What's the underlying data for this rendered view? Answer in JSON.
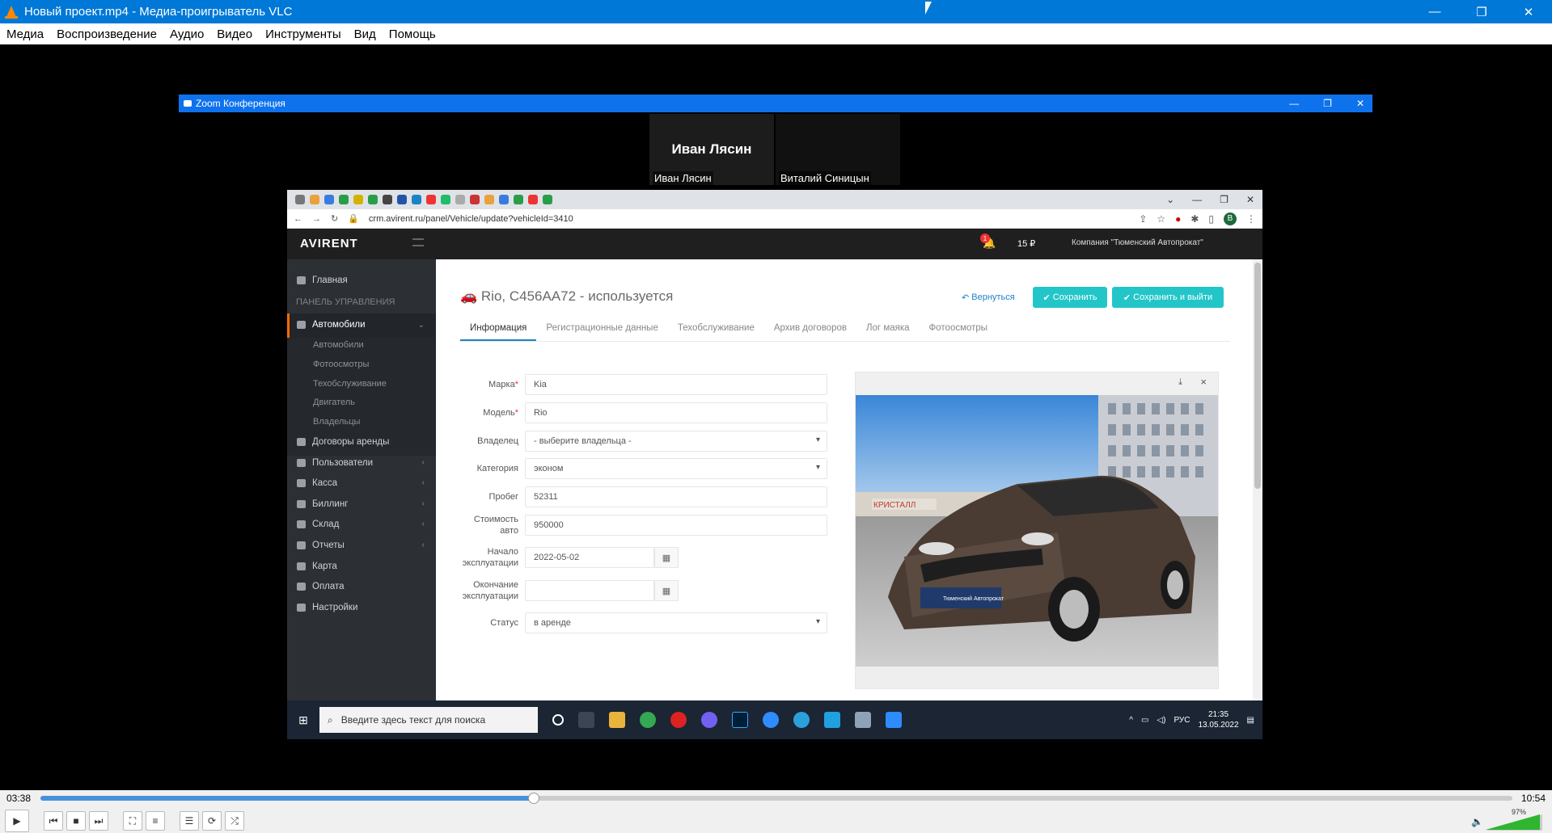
{
  "vlc": {
    "title": "Новый проект.mp4 - Медиа-проигрыватель VLC",
    "menu": [
      "Медиа",
      "Воспроизведение",
      "Аудио",
      "Видео",
      "Инструменты",
      "Вид",
      "Помощь"
    ],
    "time_current": "03:38",
    "time_total": "10:54",
    "progress": 0.335,
    "volume": "97%"
  },
  "zoom": {
    "title": "Zoom Конференция",
    "participant_1_name_big": "Иван Лясин",
    "participant_1_label": "Иван Лясин",
    "participant_2_label": "Виталий Синицын"
  },
  "browser": {
    "url": "crm.avirent.ru/panel/Vehicle/update?vehicleId=3410",
    "profile_letter": "B"
  },
  "crm": {
    "logo": "AVIRENT",
    "notifications": "1",
    "balance": "15 ₽",
    "company": "Компания \"Тюменский Автопрокат\"",
    "sidebar": {
      "home": "Главная",
      "panel_header": "ПАНЕЛЬ УПРАВЛЕНИЯ",
      "cars": "Автомобили",
      "sub": [
        "Автомобили",
        "Фотоосмотры",
        "Техобслуживание",
        "Двигатель",
        "Владельцы"
      ],
      "items": [
        "Договоры аренды",
        "Пользователи",
        "Касса",
        "Биллинг",
        "Склад",
        "Отчеты",
        "Карта",
        "Оплата",
        "Настройки"
      ]
    },
    "page_title": "Rio, С456АА72 - используется",
    "back": "Вернуться",
    "save": "Сохранить",
    "save_exit": "Сохранить и выйти",
    "tabs": [
      "Информация",
      "Регистрационные данные",
      "Техобслуживание",
      "Архив договоров",
      "Лог маяка",
      "Фотоосмотры"
    ],
    "form": {
      "brand_label": "Марка",
      "brand": "Kia",
      "model_label": "Модель",
      "model": "Rio",
      "owner_label": "Владелец",
      "owner": "- выберите владельца -",
      "category_label": "Категория",
      "category": "эконом",
      "mileage_label": "Пробег",
      "mileage": "52311",
      "cost_label": "Стоимость авто",
      "cost": "950000",
      "start_label": "Начало эксплуатации",
      "start": "2022-05-02",
      "end_label": "Окончание эксплуатации",
      "end": "",
      "status_label": "Статус",
      "status": "в аренде"
    },
    "photo_sign": "КРИСТАЛЛ",
    "plate_text": "Тюменский Автопрокат"
  },
  "taskbar": {
    "search_placeholder": "Введите здесь текст для поиска",
    "lang": "РУС",
    "time": "21:35",
    "date": "13.05.2022"
  }
}
